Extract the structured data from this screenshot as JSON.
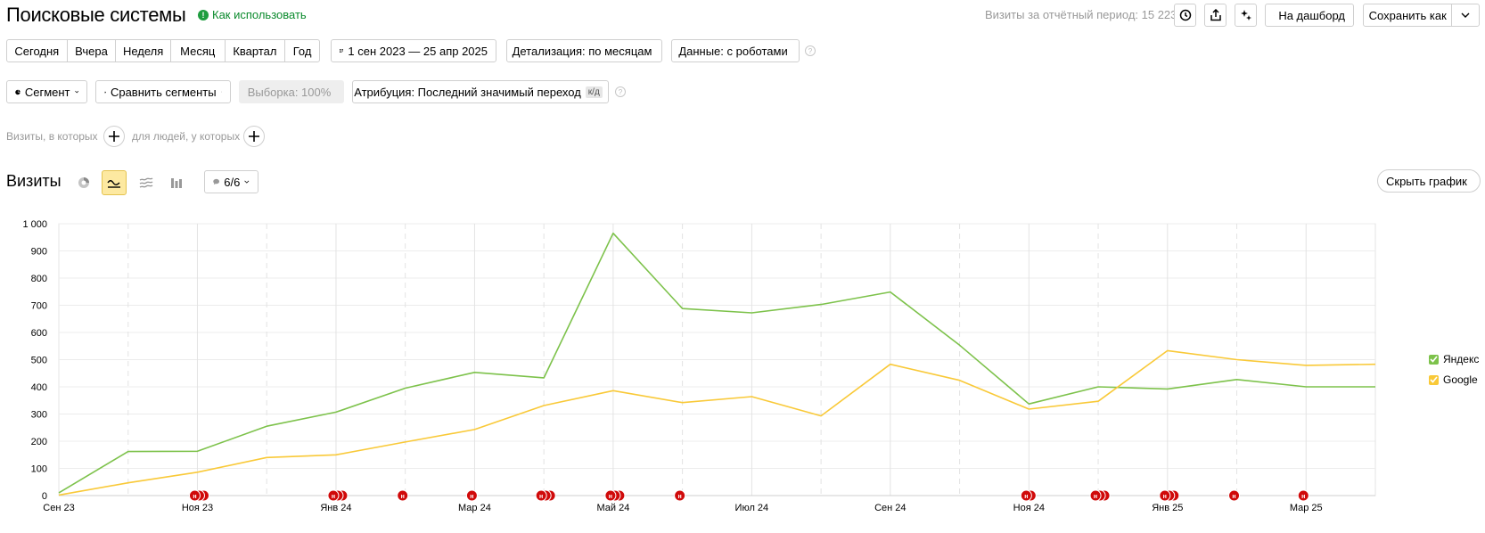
{
  "header": {
    "title": "Поисковые системы",
    "how_to_use": "Как использовать",
    "visits_period": "Визиты за отчётный период: 15 223",
    "dashboard_label": "На дашборд",
    "save_as_label": "Сохранить как"
  },
  "period_buttons": [
    "Сегодня",
    "Вчера",
    "Неделя",
    "Месяц",
    "Квартал",
    "Год"
  ],
  "date_range": "1 сен 2023 — 25 апр 2025",
  "detail": "Детализация: по месяцам",
  "data_mode": "Данные: с роботами",
  "segment": {
    "segment_label": "Сегмент",
    "compare_label": "Сравнить сегменты",
    "sample_label": "Выборка: 100%",
    "attribution_label": "Атрибуция: Последний значимый переход",
    "attribution_badge": "к/д"
  },
  "filters": {
    "visits_text": "Визиты, в которых",
    "people_text": "для людей, у которых"
  },
  "chart_section": {
    "title": "Визиты",
    "annotations_count": "6/6",
    "hide_chart_label": "Скрыть график"
  },
  "colors": {
    "yandex": "#7dc24b",
    "google": "#f9c938",
    "note_marker": "#d00a0a",
    "accent_active": "#fde9a1"
  },
  "chart_data": {
    "type": "line",
    "x": [
      "Сен 23",
      "Окт 23",
      "Ноя 23",
      "Дек 23",
      "Янв 24",
      "Фев 24",
      "Мар 24",
      "Апр 24",
      "Май 24",
      "Июн 24",
      "Июл 24",
      "Авг 24",
      "Сен 24",
      "Окт 24",
      "Ноя 24",
      "Дек 24",
      "Янв 25",
      "Фев 25",
      "Мар 25",
      "Апр 25"
    ],
    "x_tick_labels": [
      "Сен 23",
      "Ноя 23",
      "Янв 24",
      "Мар 24",
      "Май 24",
      "Июл 24",
      "Сен 24",
      "Ноя 24",
      "Янв 25",
      "Мар 25"
    ],
    "series": [
      {
        "name": "Яндекс",
        "values": [
          10,
          162,
          163,
          255,
          307,
          395,
          453,
          433,
          965,
          688,
          672,
          703,
          749,
          553,
          337,
          400,
          392,
          427,
          400,
          400
        ]
      },
      {
        "name": "Google",
        "values": [
          2,
          47,
          86,
          140,
          150,
          197,
          243,
          331,
          386,
          342,
          364,
          293,
          483,
          424,
          318,
          347,
          533,
          500,
          479,
          483
        ]
      }
    ],
    "ylim": [
      0,
      1000
    ],
    "y_ticks": [
      "0",
      "100",
      "200",
      "300",
      "400",
      "500",
      "600",
      "700",
      "800",
      "900",
      "1 000"
    ],
    "grid": true,
    "legend_position": "right",
    "note_markers": [
      {
        "month_index": 2,
        "count": 3
      },
      {
        "month_index": 4,
        "count": 3
      },
      {
        "month_index": 5,
        "count": 1
      },
      {
        "month_index": 6,
        "count": 1
      },
      {
        "month_index": 7,
        "count": 3
      },
      {
        "month_index": 8,
        "count": 3
      },
      {
        "month_index": 9,
        "count": 1
      },
      {
        "month_index": 14,
        "count": 2
      },
      {
        "month_index": 15,
        "count": 3
      },
      {
        "month_index": 16,
        "count": 3
      },
      {
        "month_index": 17,
        "count": 1
      },
      {
        "month_index": 18,
        "count": 1
      }
    ],
    "note_marker_letter": "н"
  }
}
